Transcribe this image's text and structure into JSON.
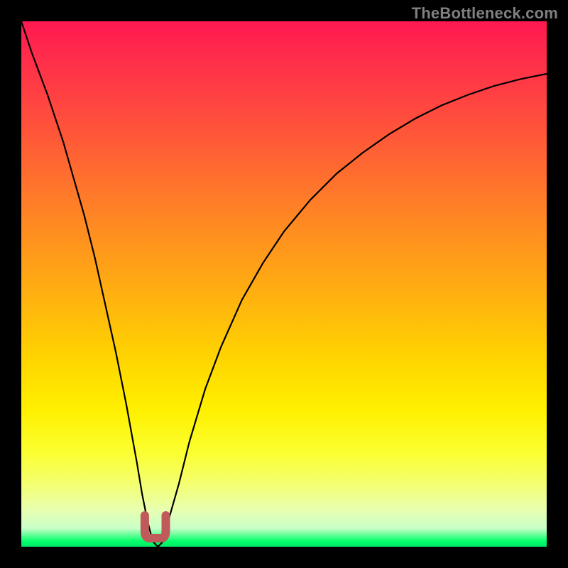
{
  "watermark": "TheBottleneck.com",
  "colors": {
    "frame": "#000000",
    "curve": "#000000",
    "bottom_marker": "#c05a5a",
    "gradient_top": "#ff1850",
    "gradient_bottom": "#00e868"
  },
  "chart_data": {
    "type": "line",
    "title": "",
    "xlabel": "",
    "ylabel": "",
    "xlim": [
      0,
      100
    ],
    "ylim": [
      0,
      100
    ],
    "grid": false,
    "series": [
      {
        "name": "bottleneck-curve",
        "x": [
          0,
          2,
          5,
          8,
          10,
          12,
          14,
          16,
          18,
          20,
          22,
          23,
          24,
          25,
          26,
          27,
          28,
          30,
          32,
          35,
          38,
          42,
          46,
          50,
          55,
          60,
          65,
          70,
          75,
          80,
          85,
          90,
          95,
          100
        ],
        "y": [
          100,
          94,
          86,
          77,
          70,
          63,
          55,
          46,
          37,
          27,
          16,
          10,
          5,
          1,
          0,
          1,
          5,
          12,
          20,
          30,
          38,
          47,
          54,
          60,
          66,
          71,
          75,
          78.5,
          81.5,
          84,
          86,
          87.7,
          89,
          90
        ]
      }
    ],
    "annotations": [
      {
        "name": "valley-marker",
        "x_range": [
          23.5,
          27.5
        ],
        "y": 0,
        "shape": "U",
        "color": "#c05a5a"
      }
    ]
  }
}
